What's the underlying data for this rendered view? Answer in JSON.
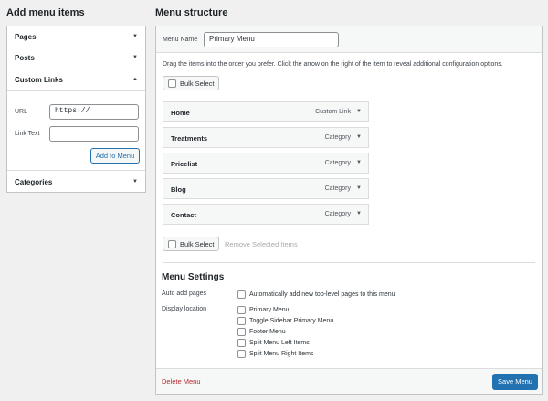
{
  "left": {
    "heading": "Add menu items",
    "sections": [
      {
        "label": "Pages",
        "arrow": "▼"
      },
      {
        "label": "Posts",
        "arrow": "▼"
      },
      {
        "label": "Custom Links",
        "arrow": "▲"
      },
      {
        "label": "Categories",
        "arrow": "▼"
      }
    ],
    "custom_links": {
      "url_label": "URL",
      "url_value": "https://",
      "link_text_label": "Link Text",
      "link_text_value": "",
      "add_button": "Add to Menu"
    }
  },
  "right": {
    "heading": "Menu structure",
    "menu_name_label": "Menu Name",
    "menu_name_value": "Primary Menu",
    "instructions": "Drag the items into the order you prefer. Click the arrow on the right of the item to reveal additional configuration options.",
    "bulk_select": "Bulk Select",
    "remove_selected": "Remove Selected Items",
    "items": [
      {
        "title": "Home",
        "type": "Custom Link"
      },
      {
        "title": "Treatments",
        "type": "Category"
      },
      {
        "title": "Pricelist",
        "type": "Category"
      },
      {
        "title": "Blog",
        "type": "Category"
      },
      {
        "title": "Contact",
        "type": "Category"
      }
    ],
    "item_arrow": "▼",
    "settings": {
      "heading": "Menu Settings",
      "auto_add_label": "Auto add pages",
      "auto_add_option": "Automatically add new top-level pages to this menu",
      "display_location_label": "Display location",
      "locations": [
        "Primary Menu",
        "Toggle Sidebar Primary Menu",
        "Footer Menu",
        "Split Menu Left Items",
        "Split Menu Right Items"
      ]
    },
    "delete_menu": "Delete Menu",
    "save_menu": "Save Menu"
  },
  "colors": {
    "accent": "#2271b1",
    "delete": "#b32d2e",
    "border": "#c3c4c7",
    "background": "#f0f0f1"
  }
}
